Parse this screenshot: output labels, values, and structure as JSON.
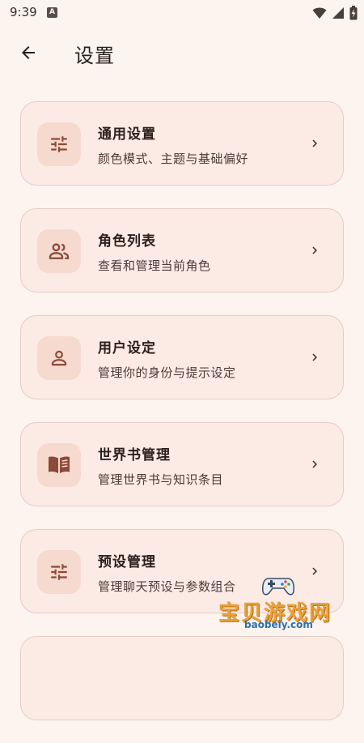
{
  "status_bar": {
    "time": "9:39",
    "notification_icon": "A"
  },
  "header": {
    "title": "设置"
  },
  "settings_items": [
    {
      "id": "general",
      "icon": "tune-icon",
      "title": "通用设置",
      "desc": "颜色模式、主题与基础偏好"
    },
    {
      "id": "characters",
      "icon": "group-icon",
      "title": "角色列表",
      "desc": "查看和管理当前角色"
    },
    {
      "id": "user",
      "icon": "person-icon",
      "title": "用户设定",
      "desc": "管理你的身份与提示设定"
    },
    {
      "id": "worldbook",
      "icon": "book-icon",
      "title": "世界书管理",
      "desc": "管理世界书与知识条目"
    },
    {
      "id": "presets",
      "icon": "tune-icon",
      "title": "预设管理",
      "desc": "管理聊天预设与参数组合"
    }
  ],
  "watermark": {
    "text": "宝贝游戏网",
    "url": "baobeiy.com"
  },
  "colors": {
    "background": "#FDF3EF",
    "card_background": "#FCEBE5",
    "icon_accent": "#8B4A3A"
  }
}
